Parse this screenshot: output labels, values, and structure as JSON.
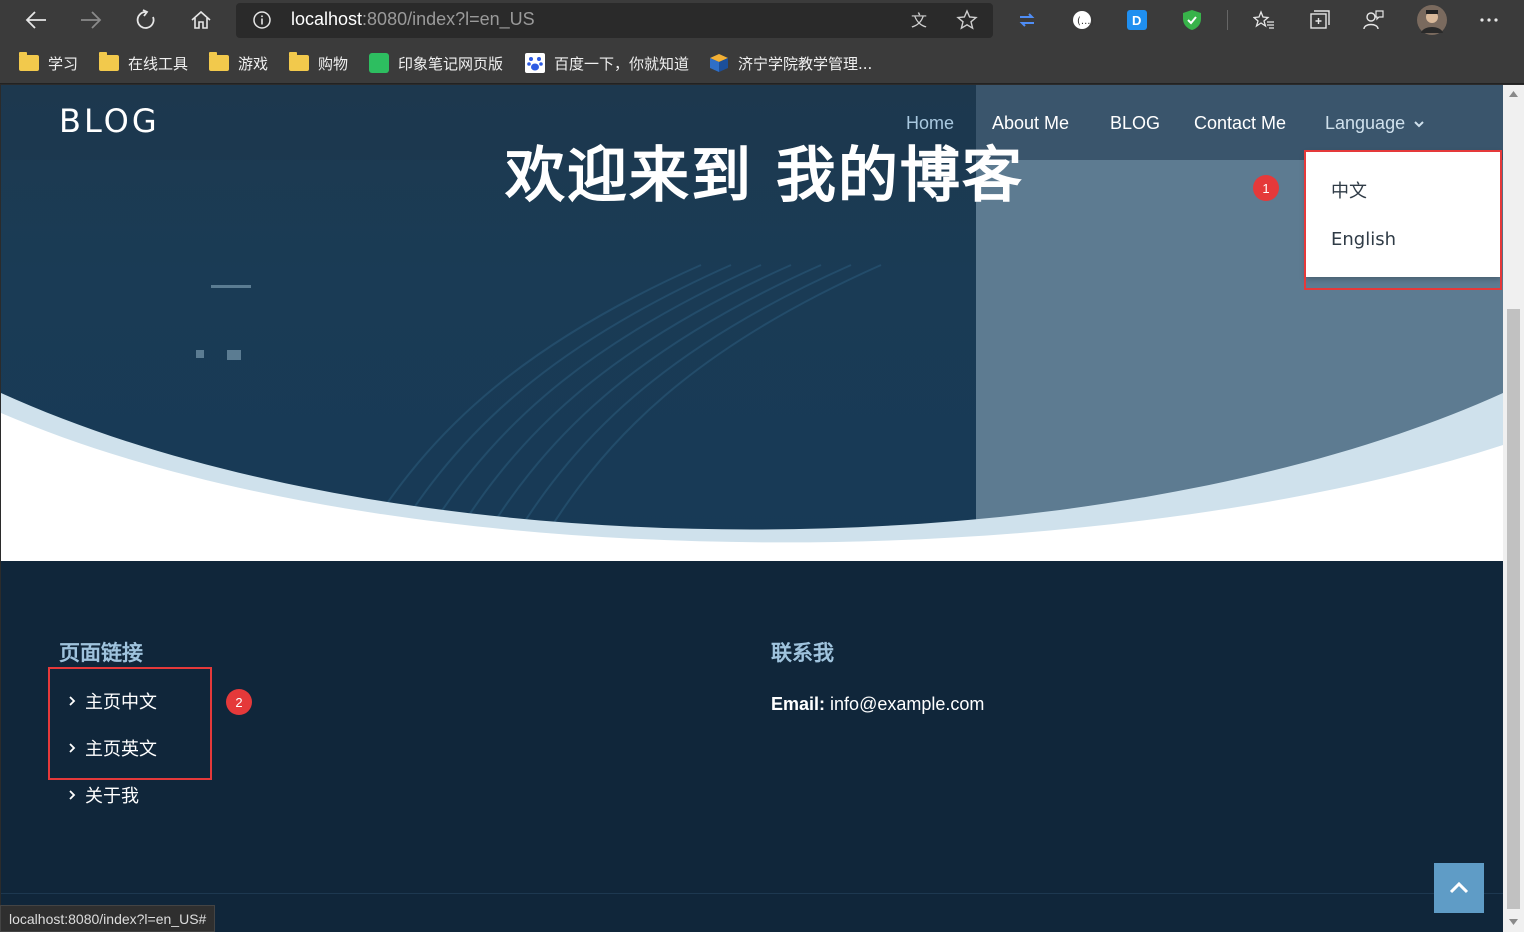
{
  "browser": {
    "url_host": "localhost",
    "url_rest": ":8080/index?l=en_US",
    "bookmarks": [
      {
        "label": "学习"
      },
      {
        "label": "在线工具"
      },
      {
        "label": "游戏"
      },
      {
        "label": "购物"
      },
      {
        "label": "印象笔记网页版"
      },
      {
        "label": "百度一下，你就知道"
      },
      {
        "label": "济宁学院教学管理..."
      }
    ],
    "status_url": "localhost:8080/index?l=en_US#"
  },
  "site": {
    "brand": "BLOG",
    "nav": {
      "home": "Home",
      "about": "About Me",
      "blog": "BLOG",
      "contact": "Contact Me",
      "language": "Language"
    },
    "hero_title": "欢迎来到 我的博客",
    "language_menu": {
      "items": [
        "中文",
        "English"
      ]
    },
    "annotations": [
      "1",
      "2"
    ],
    "footer": {
      "links_heading": "页面链接",
      "links": [
        "主页中文",
        "主页英文",
        "关于我"
      ],
      "contact_heading": "联系我",
      "email_label": "Email:",
      "email_value": "info@example.com"
    }
  },
  "colors": {
    "accent_red": "#e5393a",
    "footer_bg": "#10263a",
    "back_to_top": "#5f9cc6"
  }
}
